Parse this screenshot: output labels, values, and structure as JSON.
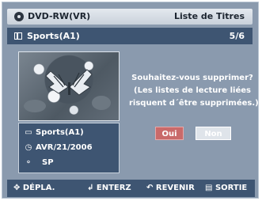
{
  "header": {
    "source": "DVD-RW(VR)",
    "title": "Liste de Titres"
  },
  "subbar": {
    "name": "Sports(A1)",
    "count": "5/6"
  },
  "info": {
    "title": "Sports(A1)",
    "date": "AVR/21/2006",
    "mode": "SP"
  },
  "dialog": {
    "line1": "Souhaitez-vous supprimer?",
    "line2": "(Les listes de lecture liées",
    "line3": "risquent d´être supprimées.)",
    "yes": "Oui",
    "no": "Non"
  },
  "footer": {
    "move": "DÉPLA.",
    "enter": "ENTERZ",
    "back": "REVENIR",
    "exit": "SORTIE"
  },
  "colors": {
    "panel": "#8a9aae",
    "bar": "#3e5572",
    "selected_button": "#c96a6a",
    "butterfly": "#e9edf2"
  },
  "icons": [
    "disc-icon",
    "title-list-icon",
    "file-icon",
    "clock-icon",
    "lock-icon",
    "move-arrows-icon",
    "enter-icon",
    "return-icon",
    "menu-icon"
  ]
}
